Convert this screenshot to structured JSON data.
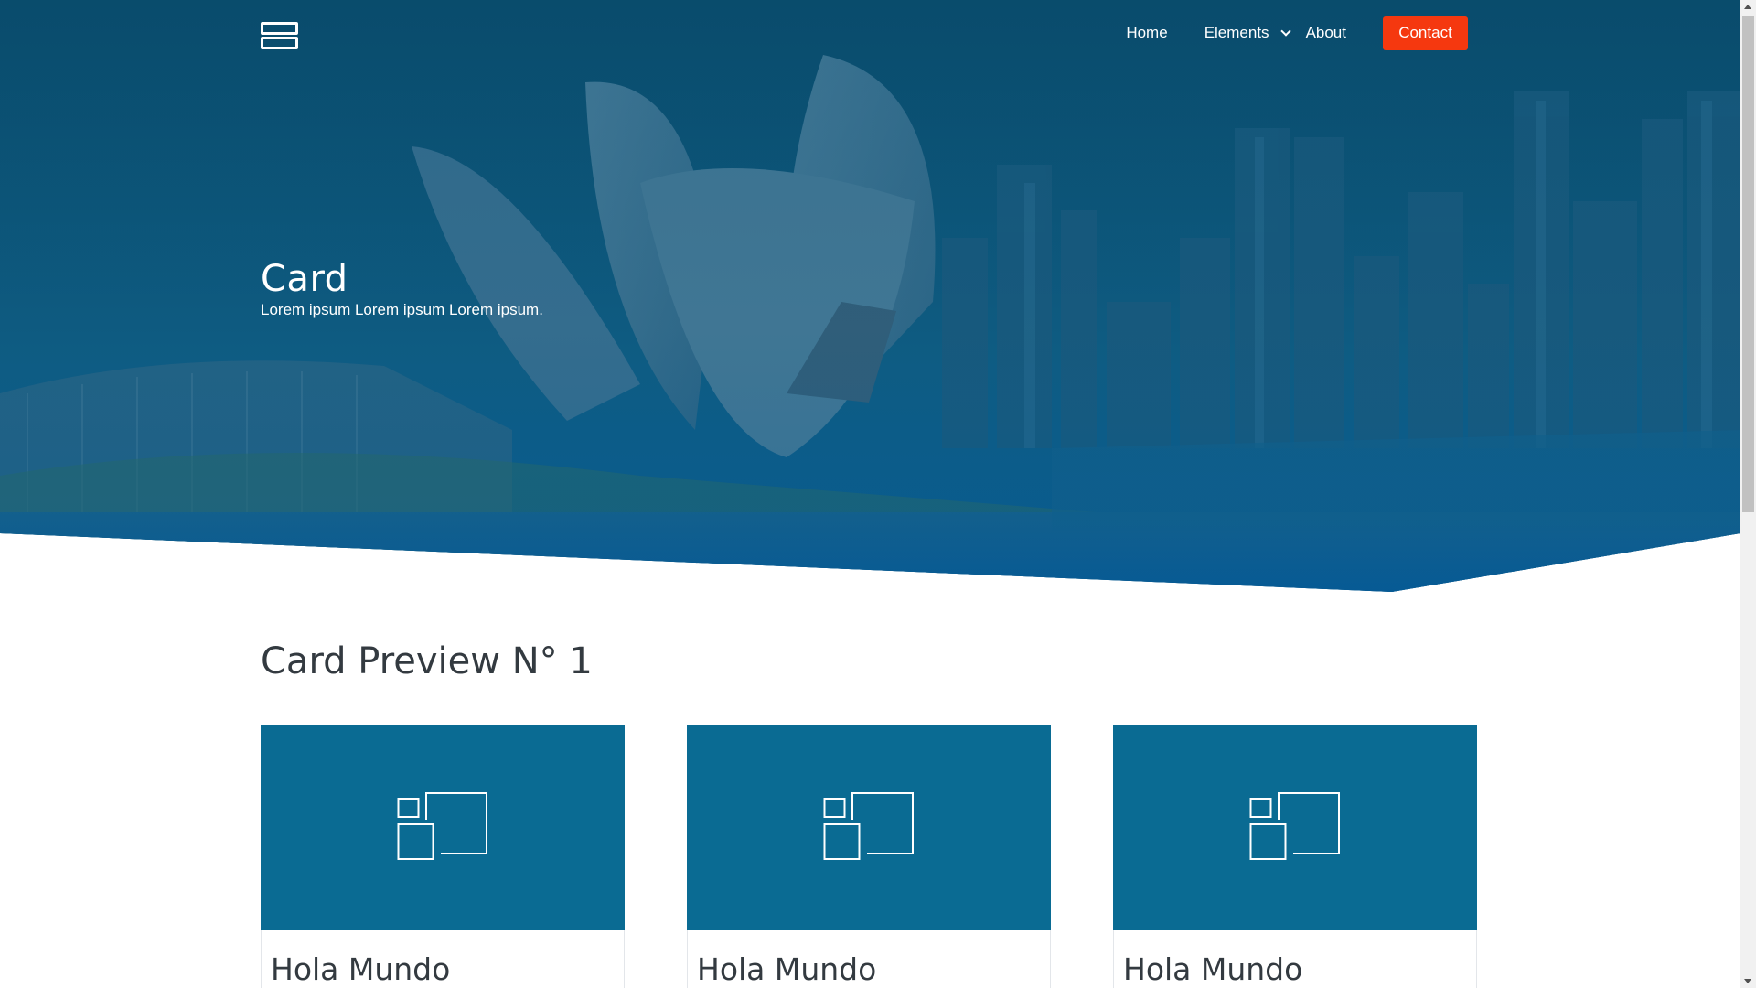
{
  "nav": {
    "brand_icon": "layers-icon",
    "home": "Home",
    "elements": "Elements",
    "about": "About",
    "contact": "Contact"
  },
  "hero": {
    "title": "Card",
    "subtitle": "Lorem ipsum Lorem ipsum Lorem ipsum."
  },
  "section": {
    "title": "Card Preview N° 1"
  },
  "cards": [
    {
      "title": "Hola Mundo",
      "icon": "image-placeholder-icon"
    },
    {
      "title": "Hola Mundo",
      "icon": "image-placeholder-icon"
    },
    {
      "title": "Hola Mundo",
      "icon": "image-placeholder-icon"
    }
  ],
  "colors": {
    "hero_blue": "#0b5b8c",
    "card_blue": "#0a6b93",
    "accent_orange": "#f5380f",
    "heading_text": "#333a40"
  }
}
